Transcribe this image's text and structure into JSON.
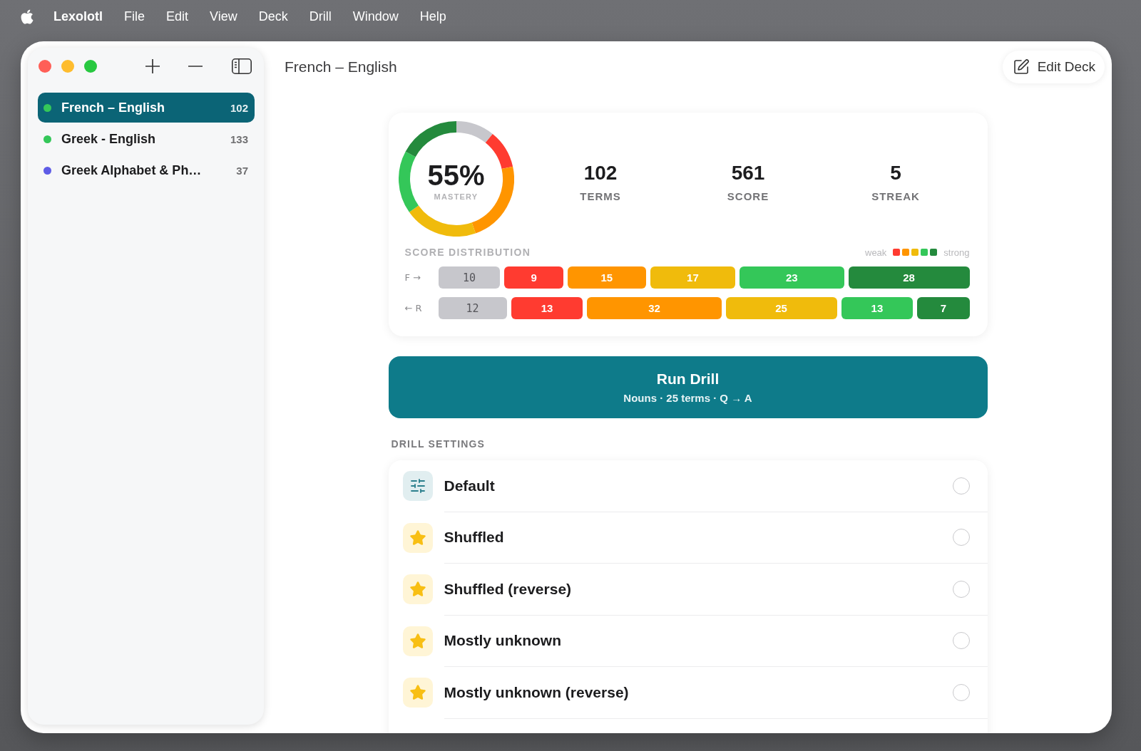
{
  "menu_bar": {
    "app_name": "Lexolotl",
    "items": [
      "File",
      "Edit",
      "View",
      "Deck",
      "Drill",
      "Window",
      "Help"
    ]
  },
  "sidebar": {
    "items": [
      {
        "label": "French – English",
        "count": "102",
        "color": "#34c759",
        "selected": true
      },
      {
        "label": "Greek - English",
        "count": "133",
        "color": "#34c759",
        "selected": false
      },
      {
        "label": "Greek Alphabet & Ph…",
        "count": "37",
        "color": "#5e5ce6",
        "selected": false
      }
    ]
  },
  "header": {
    "title": "French – English",
    "edit_button": "Edit Deck"
  },
  "summary": {
    "mastery": {
      "value": "55%",
      "label": "MASTERY"
    },
    "stats": [
      {
        "value": "102",
        "label": "TERMS"
      },
      {
        "value": "561",
        "label": "SCORE"
      },
      {
        "value": "5",
        "label": "STREAK"
      }
    ],
    "distribution": {
      "title": "SCORE DISTRIBUTION",
      "scale": {
        "low": "weak",
        "high": "strong",
        "swatches": [
          {
            "color": "#ff3b30"
          },
          {
            "color": "#ff9500"
          },
          {
            "color": "#f0bb0c"
          },
          {
            "color": "#34c759"
          },
          {
            "color": "#248a3d"
          }
        ]
      },
      "rows": [
        {
          "label": "F →",
          "segments": [
            {
              "count": "10",
              "color": "#c7c7cc"
            },
            {
              "count": "9",
              "color": "#ff3b30"
            },
            {
              "count": "15",
              "color": "#ff9500"
            },
            {
              "count": "17",
              "color": "#f0bb0c"
            },
            {
              "count": "23",
              "color": "#34c759"
            },
            {
              "count": "28",
              "color": "#248a3d"
            }
          ]
        },
        {
          "label": "← R",
          "segments": [
            {
              "count": "12",
              "color": "#c7c7cc"
            },
            {
              "count": "13",
              "color": "#ff3b30"
            },
            {
              "count": "32",
              "color": "#ff9500"
            },
            {
              "count": "25",
              "color": "#f0bb0c"
            },
            {
              "count": "13",
              "color": "#34c759"
            },
            {
              "count": "7",
              "color": "#248a3d"
            }
          ]
        }
      ]
    }
  },
  "run_button": {
    "label": "Run Drill",
    "subtitle": "Nouns · 25 terms · Q → A"
  },
  "drill_settings": {
    "title": "DRILL SETTINGS",
    "items": [
      {
        "kind": "sliders",
        "label": "Default",
        "selected": false
      },
      {
        "kind": "star",
        "label": "Shuffled",
        "selected": false
      },
      {
        "kind": "star",
        "label": "Shuffled (reverse)",
        "selected": false
      },
      {
        "kind": "star",
        "label": "Mostly unknown",
        "selected": false
      },
      {
        "kind": "star",
        "label": "Mostly unknown (reverse)",
        "selected": false
      }
    ]
  }
}
